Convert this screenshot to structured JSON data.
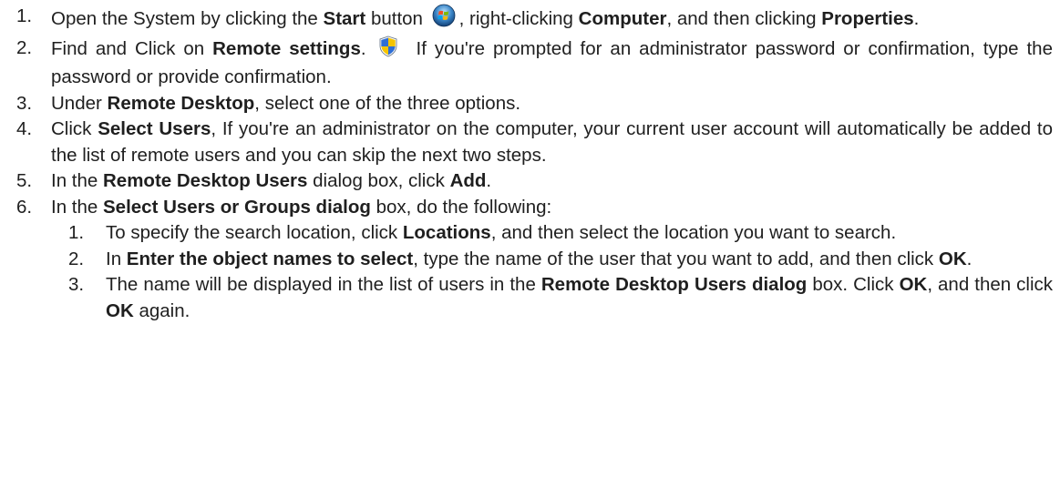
{
  "steps": [
    {
      "number": "1.",
      "t1": "Open the System by clicking the ",
      "b1": "Start",
      "t2": " button ",
      "icon": "windows-start-orb-icon",
      "t3": ", right-clicking ",
      "b2": "Computer",
      "t4": ", and then clicking ",
      "b3": "Properties",
      "t5": "."
    },
    {
      "number": "2.",
      "t1": "Find and Click on ",
      "b1": "Remote settings",
      "t2": ". ",
      "icon": "uac-shield-icon",
      "t3": "If you're prompted for an administrator password or confirmation, type the password or provide confirmation."
    },
    {
      "number": "3.",
      "t1": "Under ",
      "b1": "Remote Desktop",
      "t2": ", select one of the three options."
    },
    {
      "number": "4.",
      "t1": "Click ",
      "b1": "Select Users",
      "t2": ", If you're an administrator on the computer, your current user account will automatically be added to the list of remote users and you can skip the next two steps."
    },
    {
      "number": "5.",
      "t1": "In the ",
      "b1": "Remote Desktop Users",
      "t2": " dialog box, click ",
      "b2": "Add",
      "t3": "."
    },
    {
      "number": "6.",
      "t1": "In the ",
      "b1": "Select Users or Groups dialog",
      "t2": " box, do the following:"
    }
  ],
  "substeps": [
    {
      "number": "1.",
      "t1": "To specify the search location, click ",
      "b1": "Locations",
      "t2": ", and then select the location you want to search."
    },
    {
      "number": "2.",
      "t1": "In ",
      "b1": "Enter the object names to select",
      "t2": ", type the name of the user that you want to add, and then click ",
      "b2": "OK",
      "t3": "."
    },
    {
      "number": "3.",
      "t1": "The name will be displayed in the list of users in the ",
      "b1": "Remote Desktop Users dialog",
      "t2": " box. Click ",
      "b2": "OK",
      "t3": ", and then click ",
      "b3": "OK",
      "t4": " again."
    }
  ]
}
